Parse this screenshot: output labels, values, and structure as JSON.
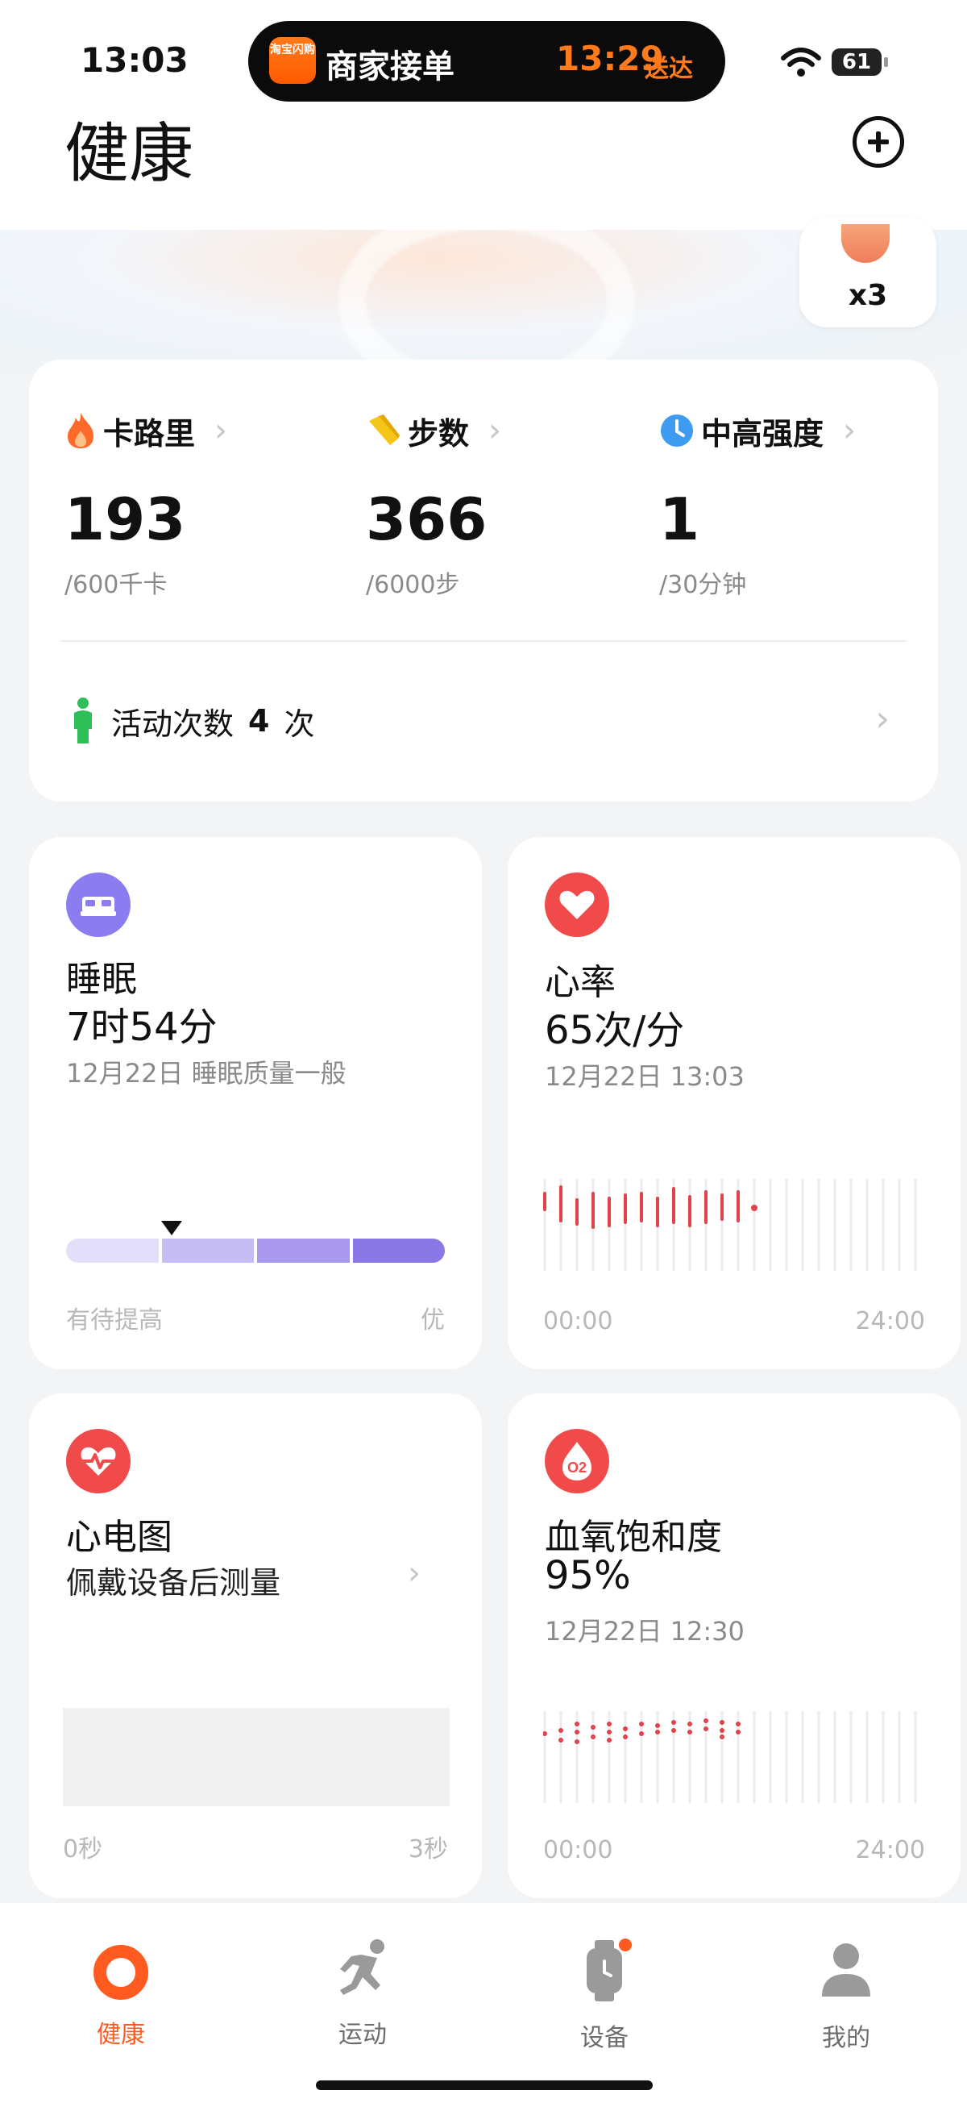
{
  "status_bar": {
    "time": "13:03",
    "island": {
      "app_icon_text": "淘宝闪购",
      "app_name": "商家接单",
      "eta_time": "13:29",
      "eta_label": "送达"
    },
    "battery": "61"
  },
  "header": {
    "title": "健康"
  },
  "hero_badge": {
    "count": "x3"
  },
  "activity": {
    "metrics": [
      {
        "name": "卡路里",
        "value": "193",
        "goal": "/600千卡",
        "icon": "flame-icon",
        "color": "#ff6a2a"
      },
      {
        "name": "步数",
        "value": "366",
        "goal": "/6000步",
        "icon": "shoe-icon",
        "color": "#f5c518"
      },
      {
        "name": "中高强度",
        "value": "1",
        "goal": "/30分钟",
        "icon": "clock-icon",
        "color": "#3d9bf0"
      }
    ],
    "sessions": {
      "label": "活动次数",
      "count": "4",
      "unit": "次"
    }
  },
  "sleep": {
    "title": "睡眠",
    "value": "7时54分",
    "subtitle": "12月22日 睡眠质量一般",
    "low_label": "有待提高",
    "high_label": "优",
    "quality_level": 0.37
  },
  "heart_rate": {
    "title": "心率",
    "value": "65次/分",
    "subtitle": "12月22日 13:03",
    "axis_start": "00:00",
    "axis_end": "24:00"
  },
  "ecg": {
    "title": "心电图",
    "subtitle": "佩戴设备后测量",
    "axis_start": "0秒",
    "axis_end": "3秒"
  },
  "spo2": {
    "title": "血氧饱和度",
    "value": "95%",
    "subtitle": "12月22日 12:30",
    "axis_start": "00:00",
    "axis_end": "24:00"
  },
  "bottom_nav": {
    "items": [
      {
        "label": "健康",
        "icon": "health-ring-icon",
        "active": true
      },
      {
        "label": "运动",
        "icon": "runner-icon",
        "active": false
      },
      {
        "label": "设备",
        "icon": "watch-icon",
        "active": false
      },
      {
        "label": "我的",
        "icon": "profile-icon",
        "active": false
      }
    ]
  }
}
